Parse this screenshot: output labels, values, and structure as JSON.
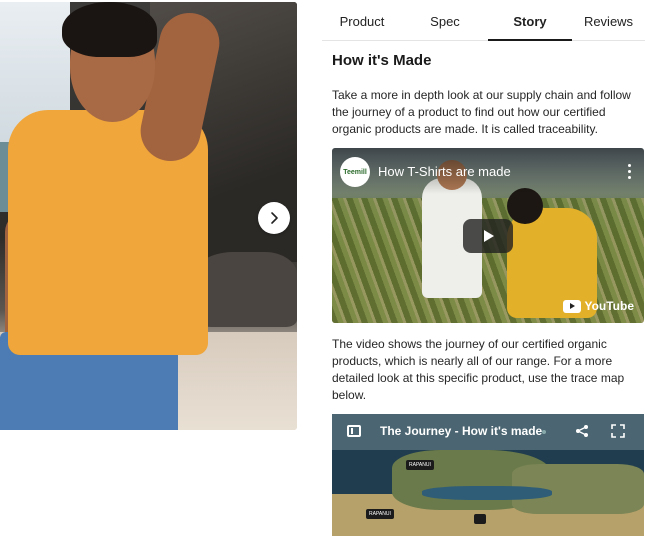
{
  "gallery": {
    "image_alt": "Man wearing orange t-shirt on beach",
    "next_icon": "chevron-right-icon"
  },
  "tabs": [
    {
      "label": "Product",
      "active": false
    },
    {
      "label": "Spec",
      "active": false
    },
    {
      "label": "Story",
      "active": true
    },
    {
      "label": "Reviews",
      "active": false
    }
  ],
  "story": {
    "heading": "How it's Made",
    "intro": "Take a more in depth look at our supply chain and follow the journey of a product to find out how our certified organic products are made. It is called traceability.",
    "video": {
      "channel_logo_text": "Teemill",
      "title": "How T-Shirts are made",
      "play_icon": "play-icon",
      "more_icon": "kebab-menu-icon",
      "provider": "YouTube"
    },
    "after_video": "The video shows the journey of our certified organic products, which is nearly all of our range. For a more detailed look at this specific product, use the trace map below.",
    "map": {
      "title": "The Journey - How it's made",
      "sidebar_icon": "sidebar-toggle-icon",
      "share_icon": "share-icon",
      "fullscreen_icon": "fullscreen-icon",
      "marker_label": "RAPANUI"
    }
  },
  "colors": {
    "accent": "#1a1a1a",
    "map_bar": "#4b6672",
    "shirt": "#f0a63a"
  }
}
